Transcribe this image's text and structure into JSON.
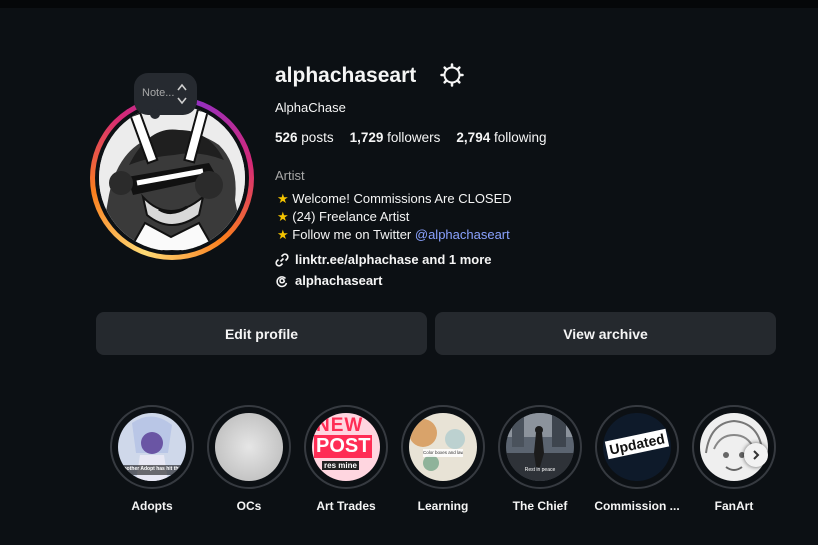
{
  "note": {
    "text": "Note..."
  },
  "profile": {
    "username": "alphachaseart",
    "full_name": "AlphaChase",
    "stats": {
      "posts_count": "526",
      "posts_label": "posts",
      "followers_count": "1,729",
      "followers_label": "followers",
      "following_count": "2,794",
      "following_label": "following"
    },
    "category": "Artist",
    "bio": {
      "line1": "Welcome! Commissions Are CLOSED",
      "line2": "(24) Freelance Artist",
      "line3_prefix": "Follow me on Twitter ",
      "line3_mention": "@alphachaseart",
      "star": "★"
    },
    "link_text": "linktr.ee/alphachase and 1 more",
    "threads_handle": "alphachaseart"
  },
  "actions": {
    "edit_profile": "Edit profile",
    "view_archive": "View archive"
  },
  "highlights": [
    {
      "label": "Adopts",
      "caption": "Another Adopt has hit the shop"
    },
    {
      "label": "OCs"
    },
    {
      "label": "Art Trades",
      "caption_top": "NEW",
      "caption_mid": "POST",
      "caption_bot": "res mine"
    },
    {
      "label": "Learning",
      "caption": "Color boxes and laws"
    },
    {
      "label": "The Chief",
      "caption": "Rest in peace"
    },
    {
      "label": "Commission ...",
      "caption": "Updated"
    },
    {
      "label": "FanArt"
    }
  ],
  "colors": {
    "background": "#0c1014",
    "button": "#25292e",
    "mention": "#8aa2ff",
    "star": "#f5c400"
  },
  "icons": {
    "settings": "gear-icon",
    "link": "link-icon",
    "threads": "threads-icon",
    "next": "chevron-right-icon"
  }
}
